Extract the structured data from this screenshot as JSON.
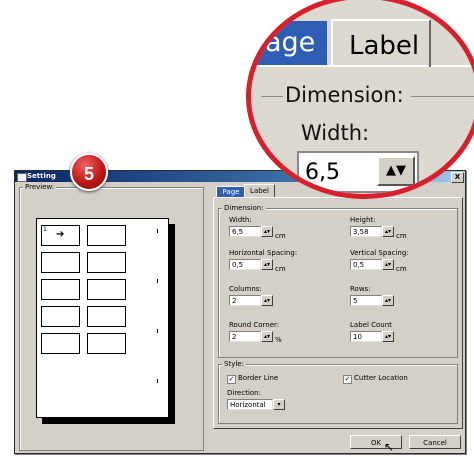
{
  "dialog": {
    "title": "Setting",
    "close_label": "X",
    "preview_label": "Preview:",
    "preview_first_label_number": "1",
    "tabs": {
      "page": "Page",
      "label": "Label"
    },
    "dimension": {
      "group_label": "Dimension:",
      "width": {
        "label": "Width:",
        "value": "6,5",
        "unit": "cm"
      },
      "height": {
        "label": "Height:",
        "value": "3,58",
        "unit": "cm"
      },
      "hspacing": {
        "label": "Horizontal Spacing:",
        "value": "0,5",
        "unit": "cm"
      },
      "vspacing": {
        "label": "Vertical Spacing:",
        "value": "0,5",
        "unit": "cm"
      },
      "columns": {
        "label": "Columns:",
        "value": "2"
      },
      "rows": {
        "label": "Rows:",
        "value": "5"
      },
      "round_corner": {
        "label": "Round Corner:",
        "value": "2",
        "unit": "%"
      },
      "label_count": {
        "label": "Label Count",
        "value": "10"
      }
    },
    "style": {
      "group_label": "Style:",
      "border_line": {
        "label": "Border Line",
        "checked": true
      },
      "cutter_location": {
        "label": "Cutter Location",
        "checked": true
      },
      "direction_label": "Direction:",
      "direction_value": "Horizontal"
    },
    "buttons": {
      "ok": "OK",
      "cancel": "Cancel"
    }
  },
  "zoom": {
    "page_tab": "age",
    "label_tab": "Label",
    "dimension": "Dimension:",
    "width_label": "Width:",
    "width_value": "6,5"
  },
  "step_badge": "5",
  "colors": {
    "callout": "#d8202c",
    "badge": "#c01818",
    "titlebar": "#0a246a"
  }
}
